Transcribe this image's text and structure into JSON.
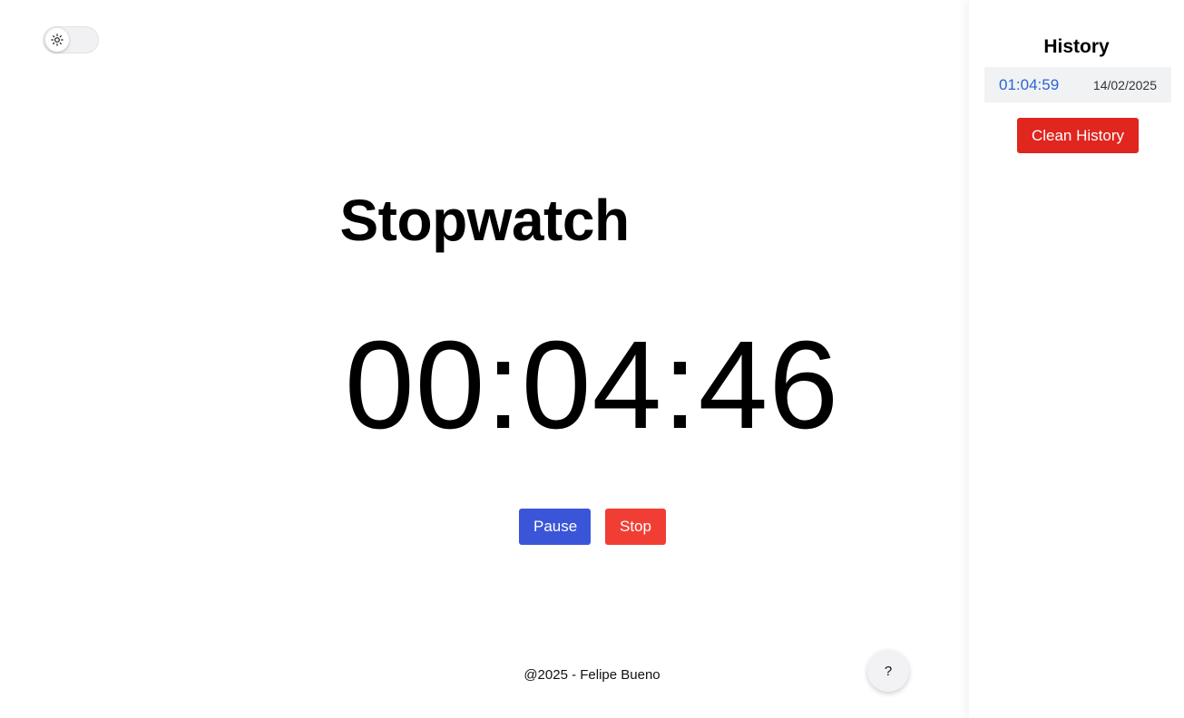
{
  "theme_toggle": {
    "icon": "sun-icon",
    "state": "light"
  },
  "main": {
    "title": "Stopwatch",
    "time": "00:04:46",
    "pause_label": "Pause",
    "stop_label": "Stop",
    "footer": "@2025 - Felipe Bueno",
    "help_label": "?"
  },
  "history": {
    "title": "History",
    "items": [
      {
        "time": "01:04:59",
        "date": "14/02/2025"
      }
    ],
    "clean_label": "Clean History"
  },
  "colors": {
    "pause": "#3b55d9",
    "stop": "#f03e35",
    "clean": "#e1251f",
    "history_time": "#2c63d6"
  }
}
